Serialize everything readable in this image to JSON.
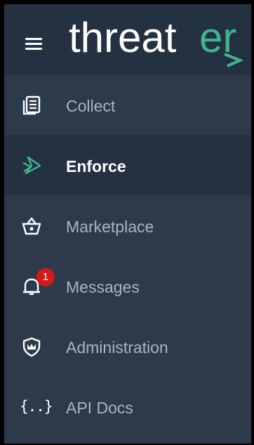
{
  "brand": {
    "name": "threater",
    "wordmark_prefix": "threat",
    "wordmark_suffix": "er",
    "accent_color": "#3fb58e",
    "text_color": "#ffffff"
  },
  "header": {
    "menu_icon": "hamburger-menu-icon"
  },
  "nav": {
    "items": [
      {
        "label": "Collect",
        "icon": "collect-icon",
        "active": false
      },
      {
        "label": "Enforce",
        "icon": "enforce-icon",
        "active": true
      },
      {
        "label": "Marketplace",
        "icon": "basket-icon",
        "active": false
      },
      {
        "label": "Messages",
        "icon": "bell-icon",
        "active": false,
        "badge": "1"
      },
      {
        "label": "Administration",
        "icon": "shield-crown-icon",
        "active": false
      },
      {
        "label": "API Docs",
        "icon": "braces-icon",
        "active": false,
        "glyph": "{..}"
      }
    ]
  },
  "colors": {
    "sidebar_bg": "#2c3a4c",
    "active_bg": "#243140",
    "inactive_text": "#aab4c0",
    "badge_bg": "#d21a1a"
  }
}
